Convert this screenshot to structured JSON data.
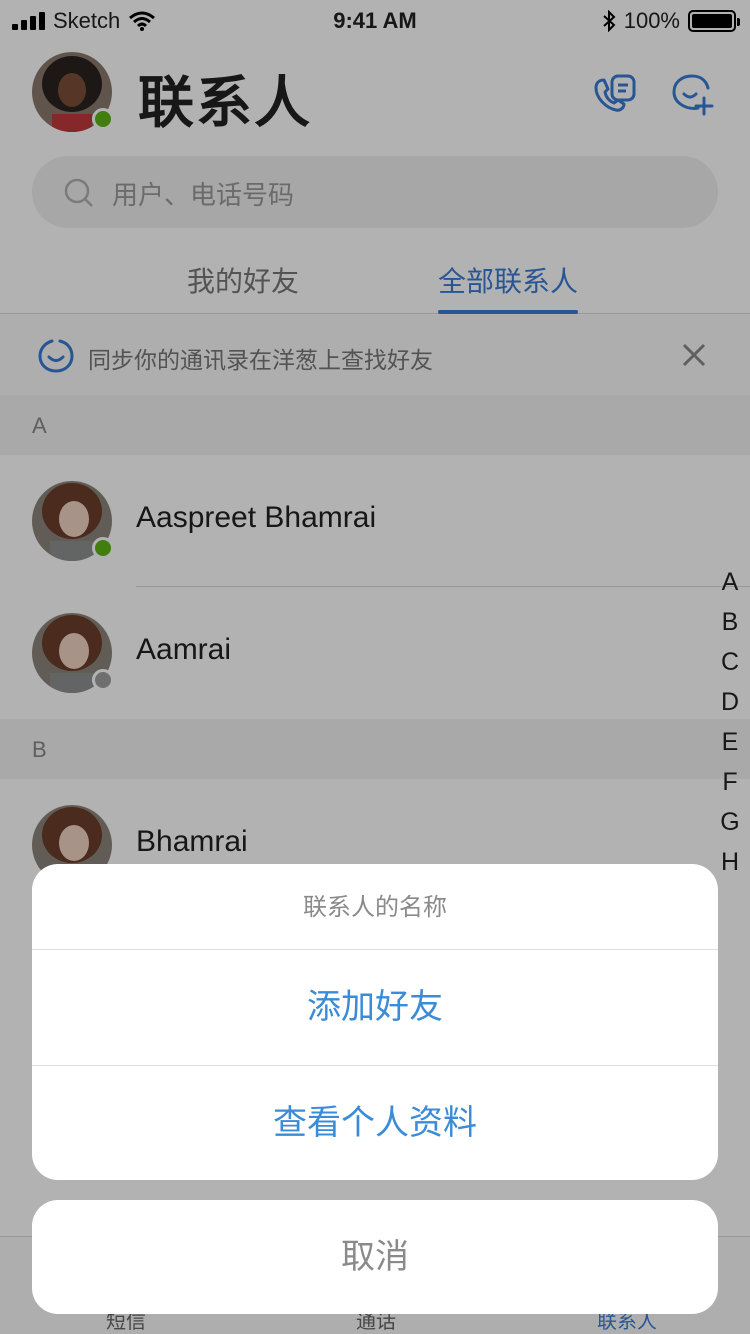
{
  "status_bar": {
    "carrier": "Sketch",
    "time": "9:41 AM",
    "battery": "100%",
    "signal_bars": 4,
    "wifi_icon": "wifi-icon",
    "bluetooth_icon": "bluetooth-icon"
  },
  "header": {
    "title": "联系人",
    "avatar_status": "online",
    "icons": [
      "call-log-icon",
      "add-friend-icon"
    ]
  },
  "search": {
    "placeholder": "用户、电话号码"
  },
  "tabs": [
    {
      "label": "我的好友",
      "active": false
    },
    {
      "label": "全部联系人",
      "active": true
    }
  ],
  "sync_banner": {
    "text": "同步你的通讯录在洋葱上查找好友"
  },
  "sections": [
    {
      "letter": "A",
      "contacts": [
        {
          "name": "Aaspreet Bhamrai",
          "status": "online"
        },
        {
          "name": "Aamrai",
          "status": "offline"
        }
      ]
    },
    {
      "letter": "B",
      "contacts": [
        {
          "name": "Bhamrai",
          "status": ""
        }
      ]
    }
  ],
  "index_letters": [
    "A",
    "B",
    "C",
    "D",
    "E",
    "F",
    "G",
    "H"
  ],
  "bottom_nav": [
    "短信",
    "通话",
    "联系人"
  ],
  "action_sheet": {
    "title": "联系人的名称",
    "actions": [
      "添加好友",
      "查看个人资料"
    ],
    "cancel": "取消"
  },
  "colors": {
    "accent": "#3a7bd5",
    "action_blue": "#3a8bd8",
    "online": "#5fb318",
    "offline": "#a0a0a0"
  }
}
